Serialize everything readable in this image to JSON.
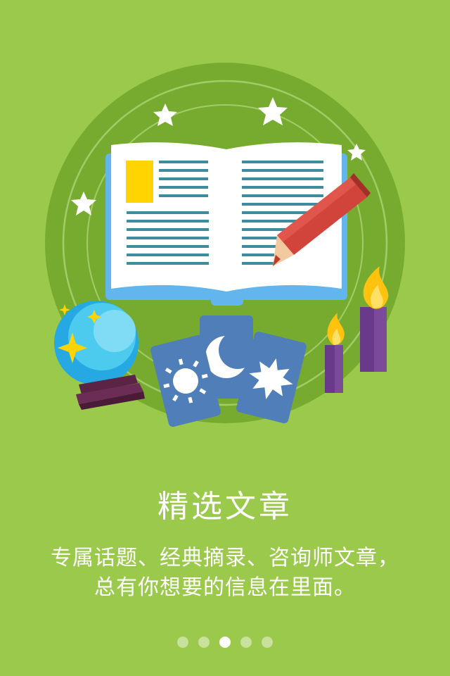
{
  "onboarding": {
    "title": "精选文章",
    "subtitle_line1": "专属话题、经典摘录、咨询师文章，",
    "subtitle_line2": "总有你想要的信息在里面。",
    "page_count": 5,
    "active_page": 3
  },
  "colors": {
    "background": "#9bc94c",
    "circle": "#77ab2f",
    "text": "#ffffff"
  }
}
